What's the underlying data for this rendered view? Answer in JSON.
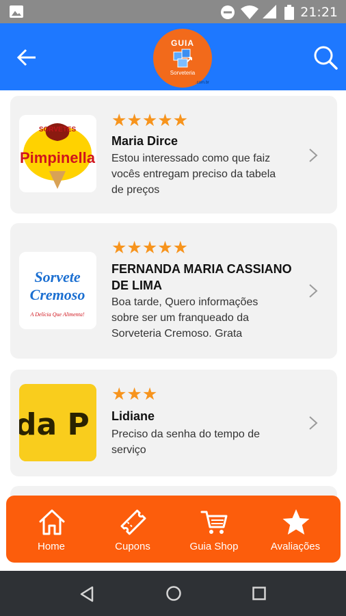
{
  "status_bar": {
    "time": "21:21",
    "icons": [
      "image-icon",
      "do-not-disturb-icon",
      "wifi-icon",
      "signal-icon",
      "battery-icon"
    ]
  },
  "app_bar": {
    "logo_top_text": "GUIA",
    "logo_bottom_text": "Sorveteria",
    "logo_domain": ".com.br",
    "icons": [
      "back-arrow-icon",
      "search-icon"
    ]
  },
  "reviews": [
    {
      "stars": "★★★★★",
      "rating": 5,
      "name_lines": [
        "Maria Dirce"
      ],
      "message_lines": [
        "Estou interessado como que faiz",
        "vocês entregam preciso da tabela",
        "de preços"
      ],
      "logo": {
        "top": "SORVETES",
        "main": "Pimpinella"
      }
    },
    {
      "stars": "★★★★★",
      "rating": 5,
      "name_lines": [
        "FERNANDA MARIA CASSIANO",
        "DE LIMA"
      ],
      "message_lines": [
        "Boa tarde, Quero informações",
        "sobre ser um franqueado da",
        "Sorveteria Cremoso. Grata"
      ],
      "logo": {
        "top": "Sorvete",
        "main": "Cremoso",
        "tagline": "A Delícia Que Alimenta!"
      }
    },
    {
      "stars": "★★★",
      "rating": 3,
      "name_lines": [
        "Lidiane"
      ],
      "message_lines": [
        "Preciso da senha do tempo de",
        "serviço"
      ],
      "logo": {
        "main": "da P"
      }
    }
  ],
  "bottom_nav": {
    "items": [
      {
        "label": "Home",
        "icon": "home-icon"
      },
      {
        "label": "Cupons",
        "icon": "ticket-icon"
      },
      {
        "label": "Guia Shop",
        "icon": "cart-icon"
      },
      {
        "label": "Avaliações",
        "icon": "star-icon"
      }
    ]
  },
  "colors": {
    "app_bar": "#1e78ff",
    "accent_orange": "#fc5d0c",
    "star": "#f7941d",
    "card_bg": "#f2f2f2"
  }
}
